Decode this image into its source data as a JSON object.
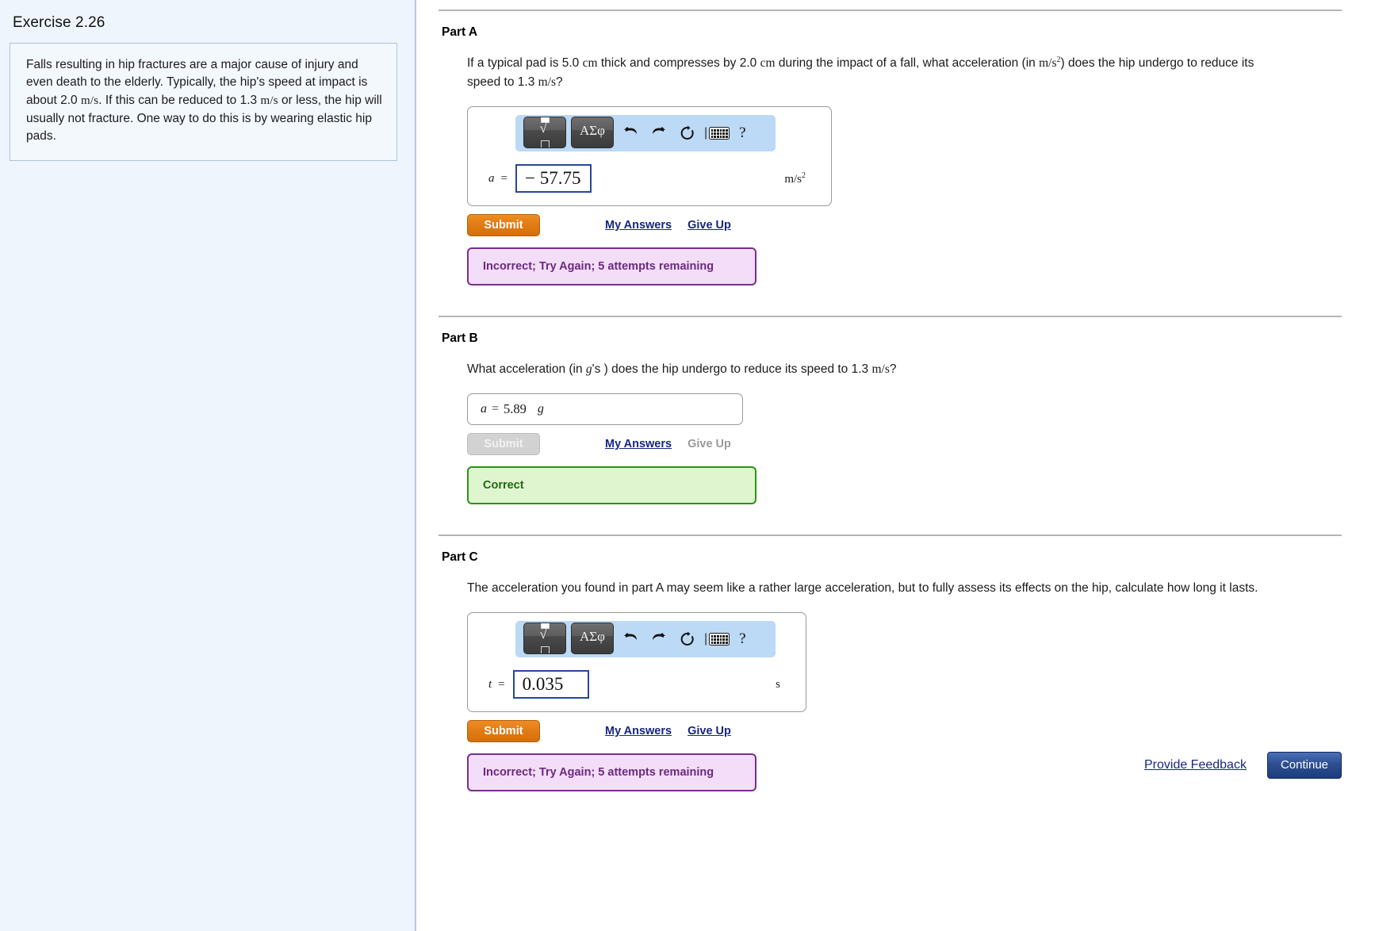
{
  "exercise": {
    "title": "Exercise 2.26",
    "statement_lines": [
      "Falls resulting in hip fractures are a major cause of",
      "injury and even death to the elderly. Typically, the hip's",
      "speed at impact is about 2.0 m/s. If this can be reduced",
      "to 1.3 m/s or less, the hip will usually not fracture. One",
      "way to do this is by wearing elastic hip pads."
    ]
  },
  "toolbar": {
    "template_button_label": "√",
    "symbol_button_label": "ΑΣφ",
    "undo_name": "undo",
    "redo_name": "redo",
    "reset_name": "reset",
    "keyboard_name": "keyboard",
    "help_label": "?"
  },
  "parts": [
    {
      "label": "Part A",
      "question_pre": "If a typical pad is 5.0 ",
      "q_u1": "cm",
      "question_mid1": " thick and compresses by 2.0 ",
      "q_u2": "cm",
      "question_mid2": " during the impact of a fall, what acceleration (in ",
      "q_unit_base": "m/s",
      "q_unit_exp": "2",
      "question_mid3": ") does the hip undergo to reduce its speed to 1.3 ",
      "q_u3": "m/s",
      "question_end": "?",
      "var_symbol": "a",
      "equals": "=",
      "value": "− 57.75",
      "unit_base": "m/s",
      "unit_exp": "2",
      "submit_label": "Submit",
      "my_answers_label": "My Answers",
      "give_up_label": "Give Up",
      "banner_text": "Incorrect; Try Again; 5 attempts remaining",
      "banner_state": "incorrect"
    },
    {
      "label": "Part B",
      "question_pre": "What acceleration (in ",
      "q_italic": "g",
      "question_mid1": "'s ) does the hip undergo to reduce its speed to 1.3 ",
      "q_u3": "m/s",
      "question_end": "?",
      "var_symbol": "a",
      "equals": "=",
      "value": "5.89",
      "unit": "g",
      "submit_label": "Submit",
      "my_answers_label": "My Answers",
      "give_up_label": "Give Up",
      "banner_text": "Correct",
      "banner_state": "correct"
    },
    {
      "label": "Part C",
      "question_line1": "The acceleration you found in part A may seem like a rather large acceleration, but to fully assess its effects on the hip, calculate how long it",
      "question_line2": "lasts.",
      "var_symbol": "t",
      "equals": "=",
      "value": "0.035",
      "unit": "s",
      "submit_label": "Submit",
      "my_answers_label": "My Answers",
      "give_up_label": "Give Up",
      "banner_text": "Incorrect; Try Again; 5 attempts remaining",
      "banner_state": "incorrect"
    }
  ],
  "footer": {
    "feedback_label": "Provide Feedback",
    "continue_label": "Continue"
  },
  "colors": {
    "submit_orange": "#e07b14",
    "link_blue": "#17277d",
    "incorrect_purple": "#7b2d8e",
    "correct_green": "#2c9413",
    "toolbar_blue": "#bcd9f5",
    "continue_navy": "#2e4f92"
  }
}
